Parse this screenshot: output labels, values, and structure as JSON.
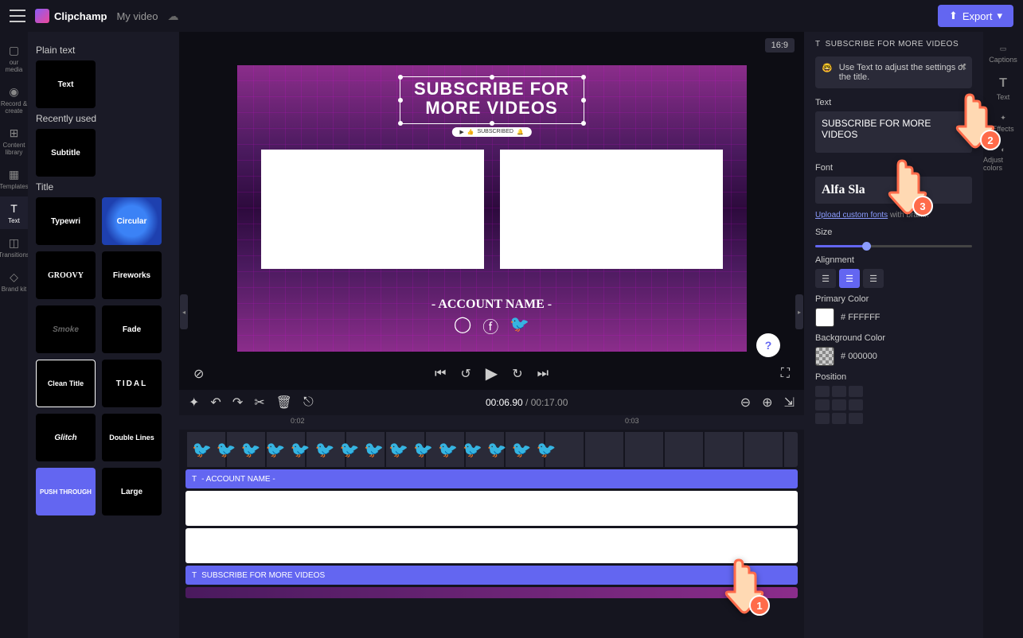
{
  "app": {
    "name": "Clipchamp",
    "video_name": "My video",
    "export_label": "Export"
  },
  "left_rail": [
    {
      "label": "our media",
      "icon": "▢"
    },
    {
      "label": "Record & create",
      "icon": "⦾"
    },
    {
      "label": "Content library",
      "icon": "⊞"
    },
    {
      "label": "Templates",
      "icon": "▦"
    },
    {
      "label": "Text",
      "icon": "T",
      "active": true
    },
    {
      "label": "Transitions",
      "icon": "◫"
    },
    {
      "label": "Brand kit",
      "icon": "◇"
    }
  ],
  "left_panel": {
    "section1": "Plain text",
    "thumb_text": "Text",
    "section2": "Recently used",
    "thumb_subtitle": "Subtitle",
    "section3": "Title",
    "titles": [
      "Typewri",
      "Circular",
      "GROOVY",
      "Fireworks",
      "Smoke",
      "Fade",
      "Clean Title",
      "TIDAL",
      "Glitch",
      "Double Lines",
      "PUSH THROUGH",
      "Large"
    ]
  },
  "preview": {
    "aspect": "16:9",
    "title_line1": "SUBSCRIBE FOR",
    "title_line2": "MORE VIDEOS",
    "subscribed": "SUBSCRIBED",
    "account": "- ACCOUNT NAME -"
  },
  "timeline": {
    "current": "00:06.90",
    "total": "00:17.00",
    "tick1": "0:02",
    "tick2": "0:03",
    "track_account": "- ACCOUNT NAME -",
    "track_subscribe": "SUBSCRIBE FOR MORE VIDEOS"
  },
  "right_rail": [
    {
      "label": "Captions",
      "icon": "CC"
    },
    {
      "label": "Text",
      "icon": "T"
    },
    {
      "label": "Effects",
      "icon": "✦"
    },
    {
      "label": "Adjust colors",
      "icon": "◐"
    }
  ],
  "right_panel": {
    "title": "SUBSCRIBE FOR MORE VIDEOS",
    "hint": "Use Text to adjust the settings of the title.",
    "label_text": "Text",
    "text_value": "SUBSCRIBE FOR MORE VIDEOS",
    "label_font": "Font",
    "font_value": "Alfa Sla",
    "upload_link": "Upload custom fonts",
    "upload_sub": " with bran...",
    "label_size": "Size",
    "label_align": "Alignment",
    "label_primary": "Primary Color",
    "primary_hex": "FFFFFF",
    "label_bg": "Background Color",
    "bg_hex": "000000",
    "label_pos": "Position"
  },
  "callouts": {
    "p1": "1",
    "p2": "2",
    "p3": "3"
  }
}
